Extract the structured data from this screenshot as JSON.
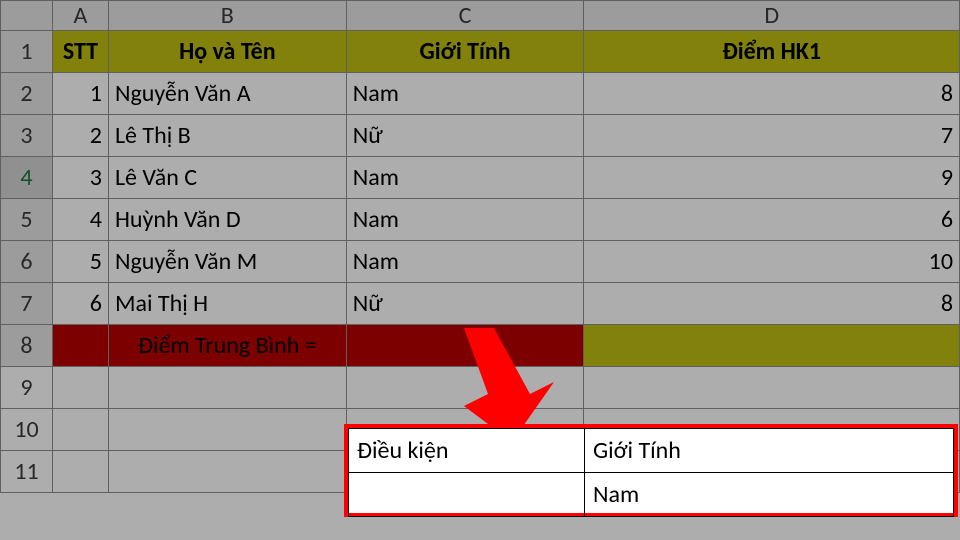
{
  "cols": {
    "a": "A",
    "b": "B",
    "c": "C",
    "d": "D"
  },
  "rows": {
    "r1": "1",
    "r2": "2",
    "r3": "3",
    "r4": "4",
    "r5": "5",
    "r6": "6",
    "r7": "7",
    "r8": "8",
    "r9": "9",
    "r10": "10",
    "r11": "11"
  },
  "header": {
    "stt": "STT",
    "name": "Họ và Tên",
    "gender": "Giới Tính",
    "score": "Điểm HK1"
  },
  "data": [
    {
      "stt": "1",
      "name": "Nguyễn Văn A",
      "gender": "Nam",
      "score": "8"
    },
    {
      "stt": "2",
      "name": "Lê Thị B",
      "gender": "Nữ",
      "score": "7"
    },
    {
      "stt": "3",
      "name": "Lê Văn C",
      "gender": "Nam",
      "score": "9"
    },
    {
      "stt": "4",
      "name": "Huỳnh Văn D",
      "gender": "Nam",
      "score": "6"
    },
    {
      "stt": "5",
      "name": "Nguyễn Văn M",
      "gender": "Nam",
      "score": "10"
    },
    {
      "stt": "6",
      "name": "Mai Thị H",
      "gender": "Nữ",
      "score": "8"
    }
  ],
  "avg_label": "Điểm Trung Bình =",
  "criteria": {
    "label": "Điều kiện",
    "col": "Giới Tính",
    "val": "Nam"
  },
  "colors": {
    "header_bg": "#c0be12",
    "avg_bg": "#b80000",
    "highlight_border": "#ff0000"
  }
}
